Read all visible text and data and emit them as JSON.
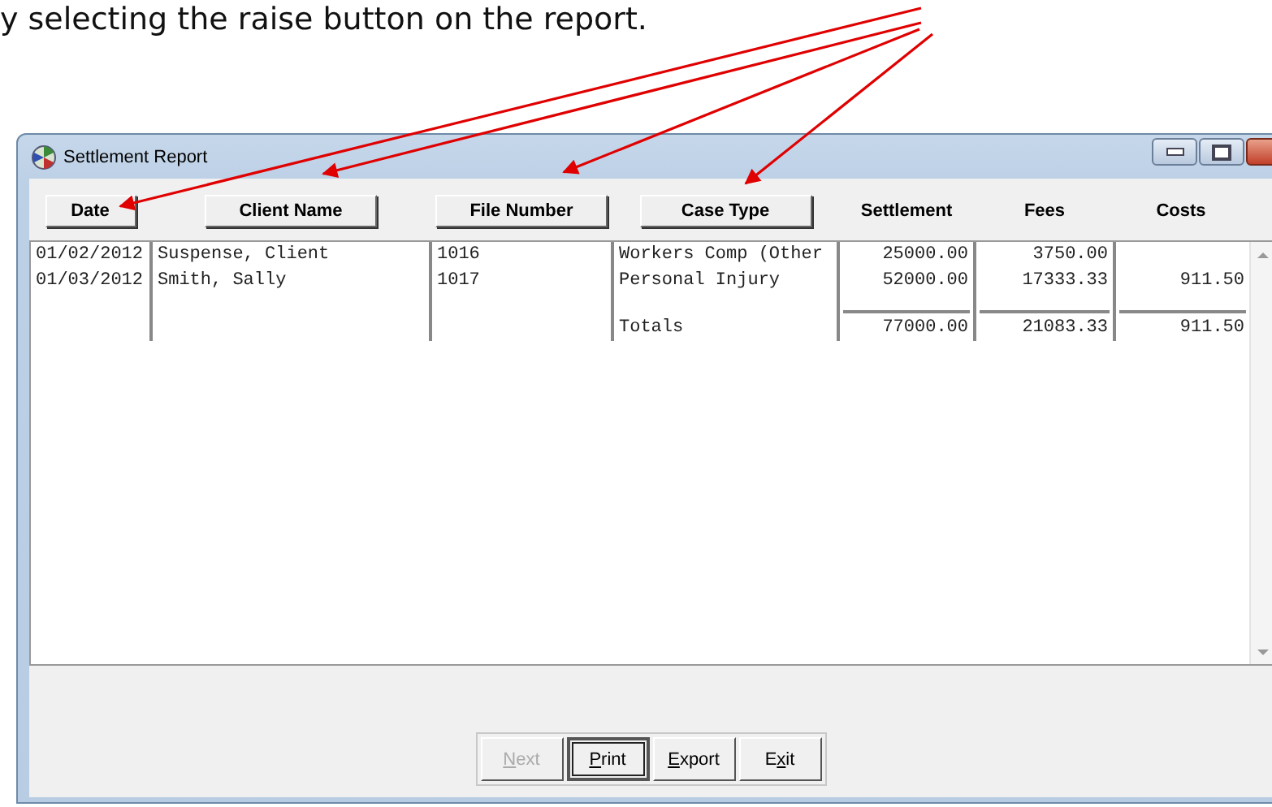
{
  "caption": "y selecting the raise button on the report.",
  "window": {
    "title": "Settlement Report"
  },
  "headers": [
    {
      "label": "Date",
      "kind": "button"
    },
    {
      "label": "Client Name",
      "kind": "button"
    },
    {
      "label": "File Number",
      "kind": "button"
    },
    {
      "label": "Case Type",
      "kind": "button"
    },
    {
      "label": "Settlement",
      "kind": "label"
    },
    {
      "label": "Fees",
      "kind": "label"
    },
    {
      "label": "Costs",
      "kind": "label"
    }
  ],
  "rows": [
    {
      "date": "01/02/2012",
      "client": "Suspense, Client",
      "file": "1016",
      "case_type": "Workers Comp (Other",
      "settlement": "25000.00",
      "fees": "3750.00"
    },
    {
      "date": "01/03/2012",
      "client": "Smith, Sally",
      "file": "1017",
      "case_type": "Personal Injury",
      "settlement": "52000.00",
      "fees": "17333.33",
      "costs": "911.50"
    }
  ],
  "totals": {
    "label": "Totals",
    "settlement": "77000.00",
    "fees": "21083.33",
    "costs": "911.50"
  },
  "buttons": [
    {
      "label": {
        "key": "N",
        "after": "ext"
      },
      "disabled": true,
      "selected": false
    },
    {
      "label": {
        "key": "P",
        "after": "rint"
      },
      "disabled": false,
      "selected": true
    },
    {
      "label": {
        "key": "E",
        "after": "xport"
      },
      "disabled": false,
      "selected": false
    },
    {
      "label": {
        "before": "E",
        "key": "x",
        "after": "it"
      },
      "disabled": false,
      "selected": false
    }
  ]
}
